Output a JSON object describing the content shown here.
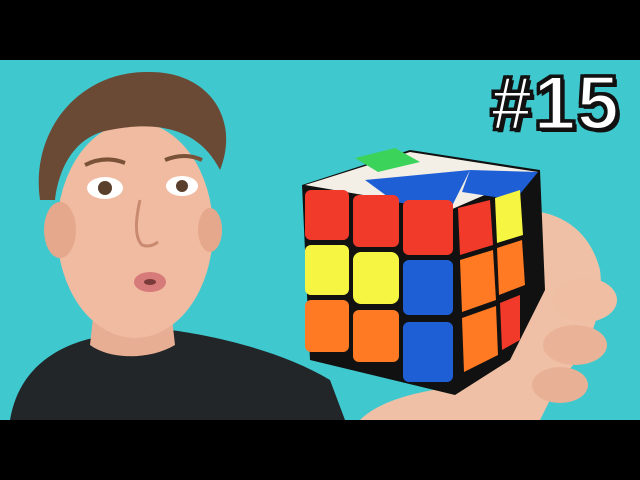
{
  "thumbnail": {
    "episode_number": "#15",
    "background_color": "#3fc9cf",
    "letterbox_color": "#000000",
    "subject": {
      "person": "person-surprised-face",
      "object": "rubiks-cube-3x3"
    },
    "cube_colors": {
      "red": "#f23a2b",
      "yellow": "#f5f542",
      "orange": "#ff7a22",
      "blue": "#1f5fd6",
      "green": "#3bd35a",
      "white": "#f4efe6"
    }
  }
}
